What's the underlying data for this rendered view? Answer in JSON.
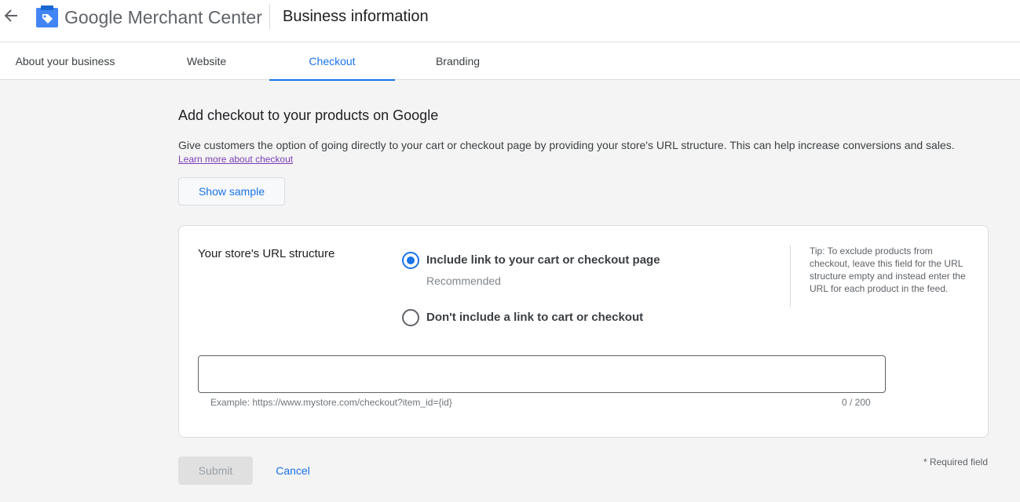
{
  "header": {
    "back_icon": "arrow-left-icon",
    "logo_icon": "merchant-tag-icon",
    "brand_google": "Google",
    "brand_product": "Merchant Center",
    "page_title": "Business information"
  },
  "tabs": [
    {
      "label": "About your business"
    },
    {
      "label": "Website"
    },
    {
      "label": "Checkout",
      "active": true
    },
    {
      "label": "Branding"
    }
  ],
  "main": {
    "heading": "Add checkout to your products on Google",
    "description": "Give customers the option of going directly to your cart or checkout page by providing your store's URL structure. This can help increase conversions and sales.",
    "learn_more": "Learn more about checkout",
    "show_sample": "Show sample"
  },
  "card": {
    "label": "Your store's URL structure",
    "options": [
      {
        "label": "Include link to your cart or checkout page",
        "sublabel": "Recommended",
        "checked": true
      },
      {
        "label": "Don't include a link to cart or checkout",
        "checked": false
      }
    ],
    "tip": "Tip: To exclude products from checkout, leave this field for the URL structure empty and instead enter the URL for each product in the feed.",
    "input_value": "",
    "hint": "Example: https://www.mystore.com/checkout?item_id={id}",
    "counter": "0 / 200"
  },
  "footer": {
    "submit": "Submit",
    "cancel": "Cancel",
    "required": "* Required field"
  },
  "colors": {
    "accent": "#1a73e8",
    "link_visited": "#7b3fb8",
    "background": "#f4f4f4"
  }
}
